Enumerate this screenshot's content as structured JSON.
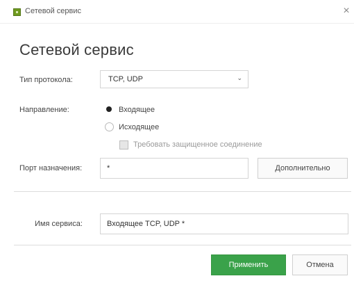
{
  "window": {
    "title": "Сетевой сервис",
    "close_glyph": "×"
  },
  "heading": "Сетевой сервис",
  "protocol": {
    "label": "Тип протокола:",
    "value": "TCP, UDP",
    "chevron": "⌄"
  },
  "direction": {
    "label": "Направление:",
    "options": [
      {
        "label": "Входящее",
        "checked": true
      },
      {
        "label": "Исходящее",
        "checked": false
      }
    ],
    "secure_checkbox": {
      "label": "Требовать защищенное соединение",
      "checked": false,
      "disabled": true
    }
  },
  "port": {
    "label": "Порт назначения:",
    "value": "*",
    "more_button": "Дополнительно"
  },
  "service": {
    "label": "Имя сервиса:",
    "value": "Входящее TCP, UDP *"
  },
  "footer": {
    "apply_button": "Применить",
    "cancel_button": "Отмена"
  },
  "colors": {
    "primary": "#3aa24a",
    "app_icon": "#6e9a1e",
    "border": "#d4d4d4"
  },
  "icons": {
    "app": "app-shield-icon",
    "close": "close-icon",
    "chevron": "chevron-down-icon"
  }
}
